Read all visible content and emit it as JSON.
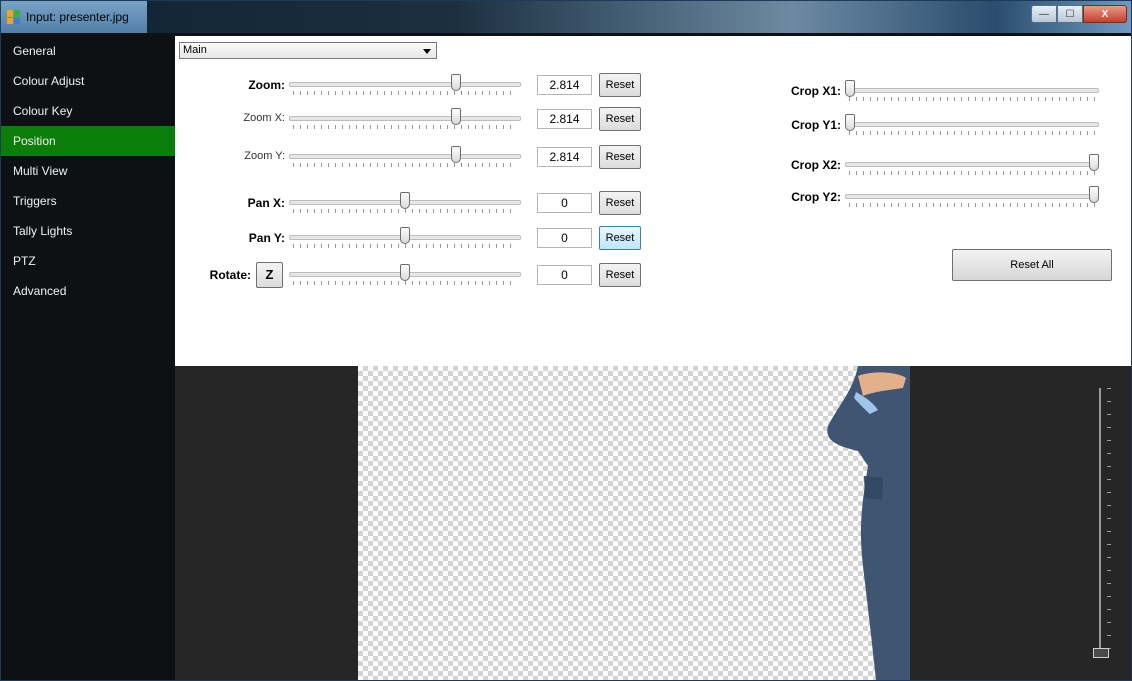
{
  "window": {
    "title": "Input: presenter.jpg",
    "minimize_label": "—",
    "maximize_label": "☐",
    "close_label": "X"
  },
  "sidebar": {
    "items": [
      {
        "label": "General"
      },
      {
        "label": "Colour Adjust"
      },
      {
        "label": "Colour Key"
      },
      {
        "label": "Position",
        "active": true
      },
      {
        "label": "Multi View"
      },
      {
        "label": "Triggers"
      },
      {
        "label": "Tally Lights"
      },
      {
        "label": "PTZ"
      },
      {
        "label": "Advanced"
      }
    ]
  },
  "layer_select": {
    "value": "Main"
  },
  "controls": {
    "zoom": {
      "label": "Zoom:",
      "value": "2.814",
      "reset": "Reset",
      "level": 0.73
    },
    "zoom_x": {
      "label": "Zoom X:",
      "value": "2.814",
      "reset": "Reset",
      "level": 0.73
    },
    "zoom_y": {
      "label": "Zoom Y:",
      "value": "2.814",
      "reset": "Reset",
      "level": 0.73
    },
    "pan_x": {
      "label": "Pan X:",
      "value": "0",
      "reset": "Reset",
      "level": 0.5
    },
    "pan_y": {
      "label": "Pan Y:",
      "value": "0",
      "reset": "Reset",
      "level": 0.5
    },
    "rotate": {
      "label": "Rotate:",
      "value": "0",
      "reset": "Reset",
      "level": 0.5,
      "z_label": "Z"
    }
  },
  "crop": {
    "x1": {
      "label": "Crop X1:",
      "level": 0
    },
    "y1": {
      "label": "Crop Y1:",
      "level": 0
    },
    "x2": {
      "label": "Crop X2:",
      "level": 1
    },
    "y2": {
      "label": "Crop Y2:",
      "level": 1
    }
  },
  "reset_all_label": "Reset All",
  "volume": {
    "level": 0
  }
}
